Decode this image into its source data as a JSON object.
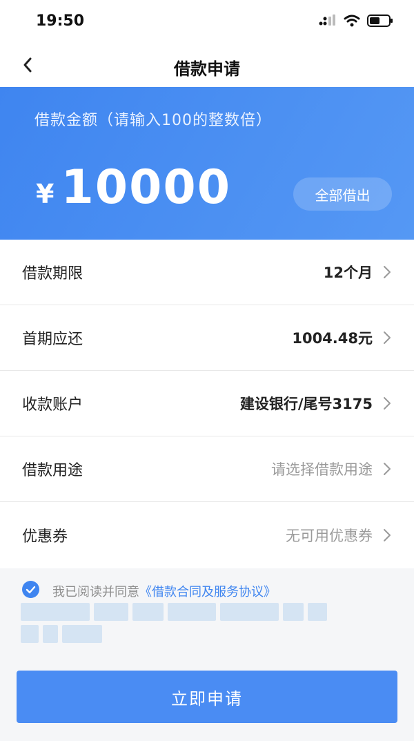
{
  "status": {
    "time": "19:50"
  },
  "nav": {
    "title": "借款申请"
  },
  "hero": {
    "label": "借款金额（请输入100的整数倍）",
    "currency": "¥",
    "amount": "10000",
    "borrow_all": "全部借出"
  },
  "rows": [
    {
      "label": "借款期限",
      "value": "12个月"
    },
    {
      "label": "首期应还",
      "value": "1004.48元"
    },
    {
      "label": "收款账户",
      "value": "建设银行/尾号3175"
    },
    {
      "label": "借款用途",
      "value": "请选择借款用途"
    },
    {
      "label": "优惠券",
      "value": "无可用优惠券"
    }
  ],
  "agreement": {
    "prefix": "我已阅读并同意",
    "link": "《借款合同及服务协议》"
  },
  "submit": {
    "label": "立即申请"
  },
  "colors": {
    "accent": "#3f85f0",
    "button": "#4a8cf3"
  }
}
